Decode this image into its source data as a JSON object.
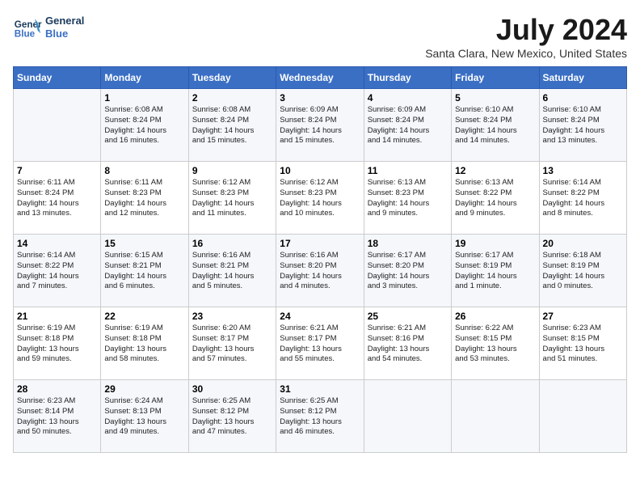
{
  "header": {
    "logo_line1": "General",
    "logo_line2": "Blue",
    "month": "July 2024",
    "location": "Santa Clara, New Mexico, United States"
  },
  "days_of_week": [
    "Sunday",
    "Monday",
    "Tuesday",
    "Wednesday",
    "Thursday",
    "Friday",
    "Saturday"
  ],
  "weeks": [
    [
      {
        "day": "",
        "info": ""
      },
      {
        "day": "1",
        "info": "Sunrise: 6:08 AM\nSunset: 8:24 PM\nDaylight: 14 hours\nand 16 minutes."
      },
      {
        "day": "2",
        "info": "Sunrise: 6:08 AM\nSunset: 8:24 PM\nDaylight: 14 hours\nand 15 minutes."
      },
      {
        "day": "3",
        "info": "Sunrise: 6:09 AM\nSunset: 8:24 PM\nDaylight: 14 hours\nand 15 minutes."
      },
      {
        "day": "4",
        "info": "Sunrise: 6:09 AM\nSunset: 8:24 PM\nDaylight: 14 hours\nand 14 minutes."
      },
      {
        "day": "5",
        "info": "Sunrise: 6:10 AM\nSunset: 8:24 PM\nDaylight: 14 hours\nand 14 minutes."
      },
      {
        "day": "6",
        "info": "Sunrise: 6:10 AM\nSunset: 8:24 PM\nDaylight: 14 hours\nand 13 minutes."
      }
    ],
    [
      {
        "day": "7",
        "info": "Sunrise: 6:11 AM\nSunset: 8:24 PM\nDaylight: 14 hours\nand 13 minutes."
      },
      {
        "day": "8",
        "info": "Sunrise: 6:11 AM\nSunset: 8:23 PM\nDaylight: 14 hours\nand 12 minutes."
      },
      {
        "day": "9",
        "info": "Sunrise: 6:12 AM\nSunset: 8:23 PM\nDaylight: 14 hours\nand 11 minutes."
      },
      {
        "day": "10",
        "info": "Sunrise: 6:12 AM\nSunset: 8:23 PM\nDaylight: 14 hours\nand 10 minutes."
      },
      {
        "day": "11",
        "info": "Sunrise: 6:13 AM\nSunset: 8:23 PM\nDaylight: 14 hours\nand 9 minutes."
      },
      {
        "day": "12",
        "info": "Sunrise: 6:13 AM\nSunset: 8:22 PM\nDaylight: 14 hours\nand 9 minutes."
      },
      {
        "day": "13",
        "info": "Sunrise: 6:14 AM\nSunset: 8:22 PM\nDaylight: 14 hours\nand 8 minutes."
      }
    ],
    [
      {
        "day": "14",
        "info": "Sunrise: 6:14 AM\nSunset: 8:22 PM\nDaylight: 14 hours\nand 7 minutes."
      },
      {
        "day": "15",
        "info": "Sunrise: 6:15 AM\nSunset: 8:21 PM\nDaylight: 14 hours\nand 6 minutes."
      },
      {
        "day": "16",
        "info": "Sunrise: 6:16 AM\nSunset: 8:21 PM\nDaylight: 14 hours\nand 5 minutes."
      },
      {
        "day": "17",
        "info": "Sunrise: 6:16 AM\nSunset: 8:20 PM\nDaylight: 14 hours\nand 4 minutes."
      },
      {
        "day": "18",
        "info": "Sunrise: 6:17 AM\nSunset: 8:20 PM\nDaylight: 14 hours\nand 3 minutes."
      },
      {
        "day": "19",
        "info": "Sunrise: 6:17 AM\nSunset: 8:19 PM\nDaylight: 14 hours\nand 1 minute."
      },
      {
        "day": "20",
        "info": "Sunrise: 6:18 AM\nSunset: 8:19 PM\nDaylight: 14 hours\nand 0 minutes."
      }
    ],
    [
      {
        "day": "21",
        "info": "Sunrise: 6:19 AM\nSunset: 8:18 PM\nDaylight: 13 hours\nand 59 minutes."
      },
      {
        "day": "22",
        "info": "Sunrise: 6:19 AM\nSunset: 8:18 PM\nDaylight: 13 hours\nand 58 minutes."
      },
      {
        "day": "23",
        "info": "Sunrise: 6:20 AM\nSunset: 8:17 PM\nDaylight: 13 hours\nand 57 minutes."
      },
      {
        "day": "24",
        "info": "Sunrise: 6:21 AM\nSunset: 8:17 PM\nDaylight: 13 hours\nand 55 minutes."
      },
      {
        "day": "25",
        "info": "Sunrise: 6:21 AM\nSunset: 8:16 PM\nDaylight: 13 hours\nand 54 minutes."
      },
      {
        "day": "26",
        "info": "Sunrise: 6:22 AM\nSunset: 8:15 PM\nDaylight: 13 hours\nand 53 minutes."
      },
      {
        "day": "27",
        "info": "Sunrise: 6:23 AM\nSunset: 8:15 PM\nDaylight: 13 hours\nand 51 minutes."
      }
    ],
    [
      {
        "day": "28",
        "info": "Sunrise: 6:23 AM\nSunset: 8:14 PM\nDaylight: 13 hours\nand 50 minutes."
      },
      {
        "day": "29",
        "info": "Sunrise: 6:24 AM\nSunset: 8:13 PM\nDaylight: 13 hours\nand 49 minutes."
      },
      {
        "day": "30",
        "info": "Sunrise: 6:25 AM\nSunset: 8:12 PM\nDaylight: 13 hours\nand 47 minutes."
      },
      {
        "day": "31",
        "info": "Sunrise: 6:25 AM\nSunset: 8:12 PM\nDaylight: 13 hours\nand 46 minutes."
      },
      {
        "day": "",
        "info": ""
      },
      {
        "day": "",
        "info": ""
      },
      {
        "day": "",
        "info": ""
      }
    ]
  ]
}
